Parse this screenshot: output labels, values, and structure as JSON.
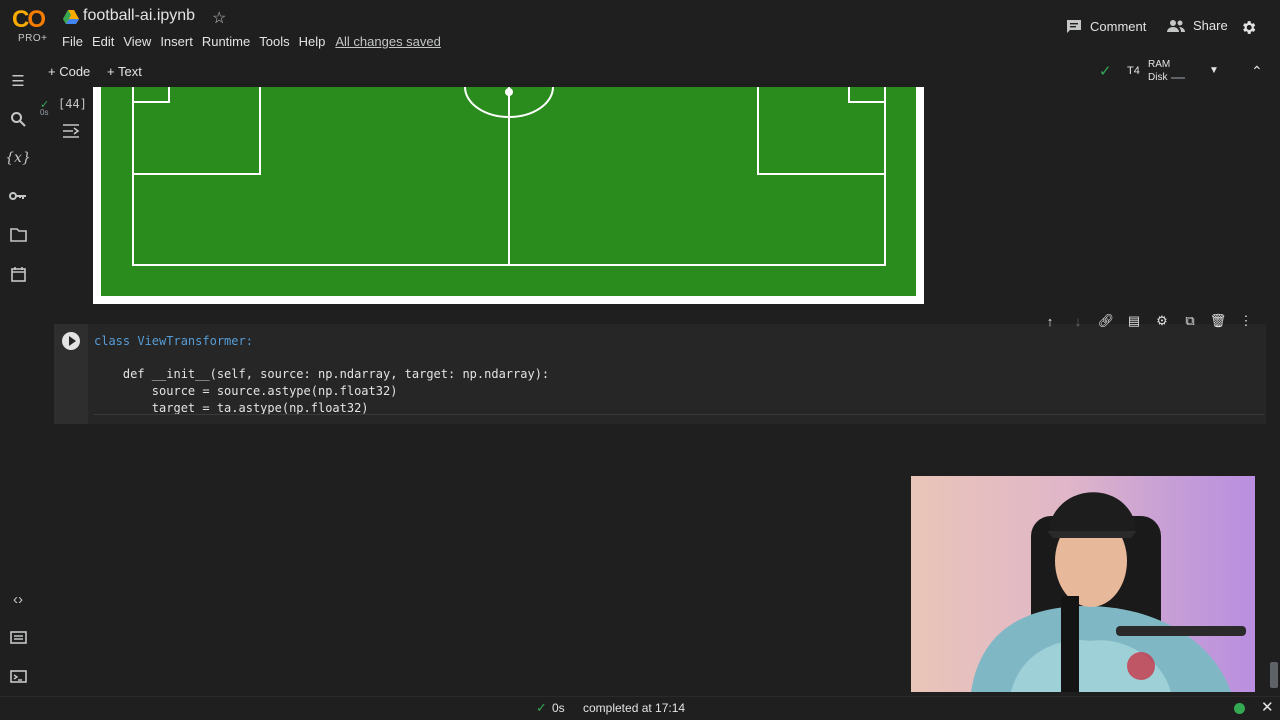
{
  "app": {
    "logo_text_a": "C",
    "logo_text_b": "O",
    "logo_tier": "PRO+",
    "notebook_title": "football-ai.ipynb"
  },
  "menu": [
    "File",
    "Edit",
    "View",
    "Insert",
    "Runtime",
    "Tools",
    "Help"
  ],
  "save_status": "All changes saved",
  "header_actions": {
    "comment_label": "Comment",
    "share_label": "Share"
  },
  "toolbar": {
    "add_code_label": "+ Code",
    "add_text_label": "+ Text",
    "runtime_type": "T4",
    "ram_label": "RAM",
    "disk_label": "Disk"
  },
  "left_rail_icons": [
    "table-of-contents-icon",
    "search-icon",
    "variables-icon",
    "secrets-key-icon",
    "files-folder-icon",
    "calendar-icon",
    "code-snippets-icon",
    "command-palette-icon",
    "terminal-icon"
  ],
  "output_cell": {
    "exec_count": "[44]",
    "exec_time": "0s"
  },
  "code_cell": {
    "lines": [
      "class ViewTransformer:",
      "",
      "    def __init__(self, source: np.ndarray, target: np.ndarray):",
      "        source = source.astype(np.float32)",
      "        target = ta.astype(np.float32)"
    ]
  },
  "cell_toolbar_icons": [
    "move-up-icon",
    "move-down-icon",
    "link-icon",
    "comment-icon",
    "cell-settings-icon",
    "mirror-cell-icon",
    "delete-icon",
    "more-vert-icon"
  ],
  "status": {
    "duration": "0s",
    "message": "completed at 17:14"
  },
  "colors": {
    "background": "#1f1f1f",
    "pitch_green": "#2b8c1e",
    "accent_green": "#34a853",
    "logo_yellow": "#f9ab00",
    "logo_orange": "#f57c00"
  }
}
